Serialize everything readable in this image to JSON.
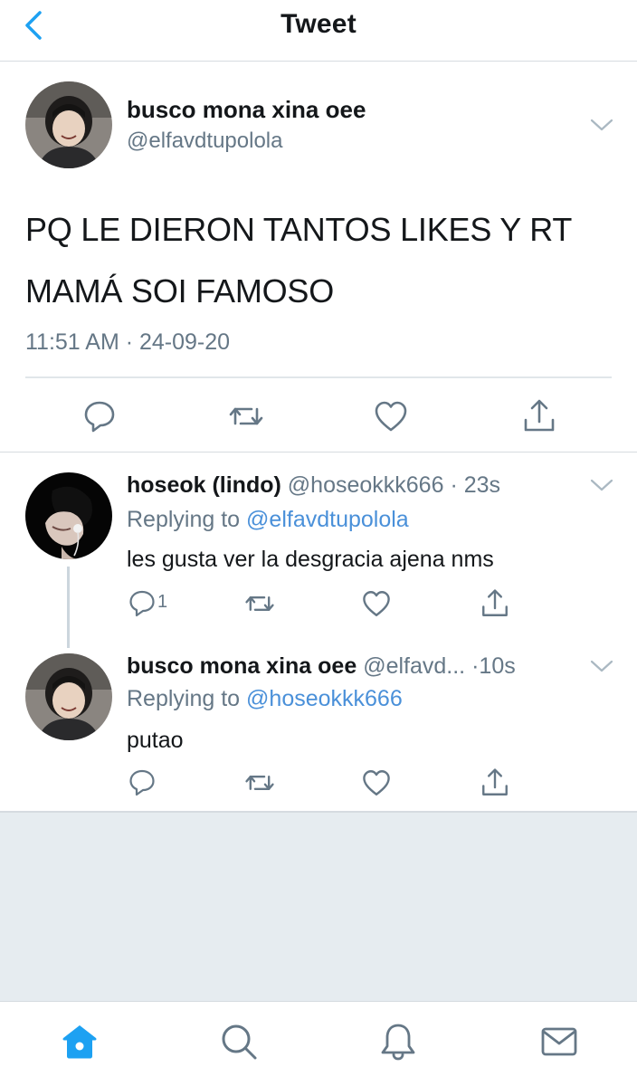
{
  "header": {
    "title": "Tweet"
  },
  "main_tweet": {
    "name": "busco mona xina oee",
    "handle": "@elfavdtupolola",
    "text_lines": [
      "PQ LE DIERON TANTOS LIKES Y RT",
      "MAMÁ SOI FAMOSO"
    ],
    "timestamp": "11:51 AM · 24-09-20"
  },
  "replies": [
    {
      "name": "hoseok (lindo)",
      "handle": "@hoseokkk666",
      "separator": "·",
      "time": "23s",
      "replying_prefix": "Replying to ",
      "replying_to": "@elfavdtupolola",
      "text": "les gusta ver la desgracia ajena nms",
      "reply_count": "1"
    },
    {
      "name": "busco mona xina oee",
      "handle": "@elfavd...",
      "separator": "·",
      "time": "10s",
      "replying_prefix": "Replying to ",
      "replying_to": "@hoseokkk666",
      "text": "putao",
      "reply_count": ""
    }
  ],
  "icons": {
    "back": "chevron-left-icon",
    "reply": "speech-bubble-icon",
    "retweet": "retweet-icon",
    "like": "heart-icon",
    "share": "share-icon",
    "home": "home-icon",
    "search": "search-icon",
    "notifications": "bell-icon",
    "messages": "mail-icon"
  },
  "colors": {
    "accent": "#1da1f2",
    "link": "#4a90d9",
    "secondary_text": "#657786",
    "icon": "#657786",
    "empty_background": "#e6ecf0"
  }
}
